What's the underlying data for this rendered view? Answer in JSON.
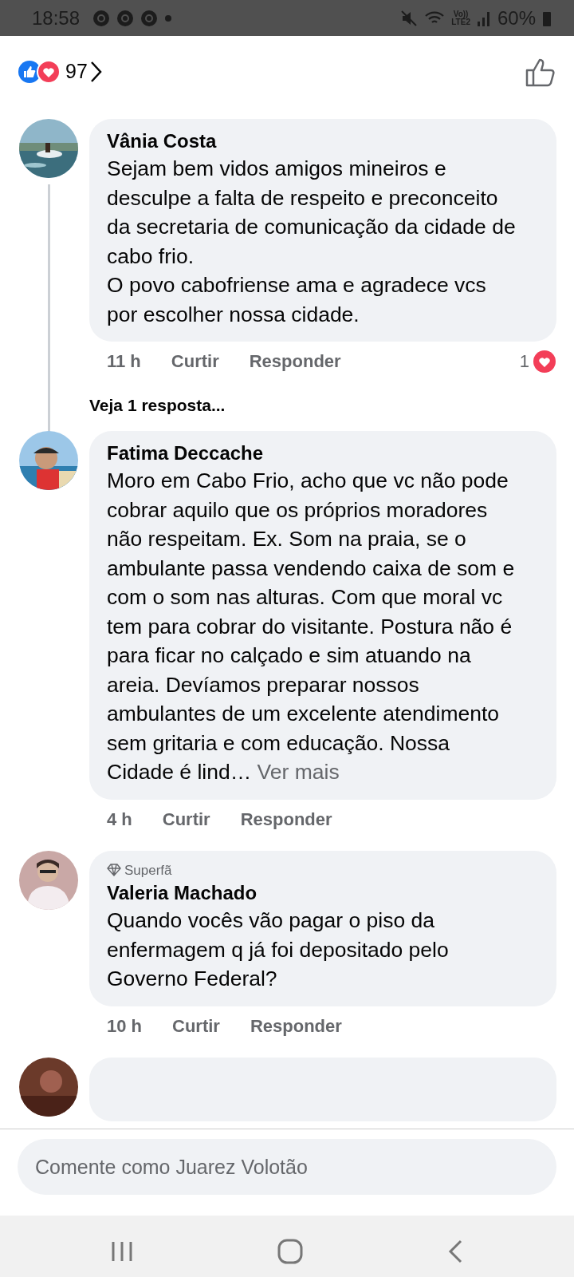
{
  "status_bar": {
    "time": "18:58",
    "volte": "Vo))",
    "network": "LTE2",
    "battery": "60%"
  },
  "reactions": {
    "count": "97"
  },
  "comments": [
    {
      "author": "Vânia Costa",
      "text": "Sejam bem vidos amigos mineiros e desculpe a falta de respeito e preconceito da secretaria de comunicação da cidade de cabo frio.\nO povo cabofriense ama e agradece vcs por escolher nossa cidade.",
      "time": "11 h",
      "like": "Curtir",
      "reply": "Responder",
      "reaction_count": "1",
      "replies_link": "Veja 1 resposta..."
    },
    {
      "author": "Fatima Deccache",
      "text": "Moro em Cabo Frio, acho que vc não pode cobrar aquilo que os próprios moradores não respeitam. Ex. Som na praia, se o ambulante passa vendendo caixa de som e com o som nas alturas. Com que moral vc tem para cobrar do visitante. Postura não é para ficar no calçado e sim atuando na areia. Devíamos preparar nossos ambulantes de um excelente atendimento sem gritaria e com educação. Nossa Cidade é lind…",
      "more": "Ver mais",
      "time": "4 h",
      "like": "Curtir",
      "reply": "Responder"
    },
    {
      "author": "Valeria Machado",
      "badge": "Superfã",
      "text": "Quando vocês vão pagar o piso da enfermagem q já foi depositado pelo Governo Federal?",
      "time": "10 h",
      "like": "Curtir",
      "reply": "Responder"
    }
  ],
  "composer": {
    "placeholder": "Comente como Juarez Volotão"
  }
}
